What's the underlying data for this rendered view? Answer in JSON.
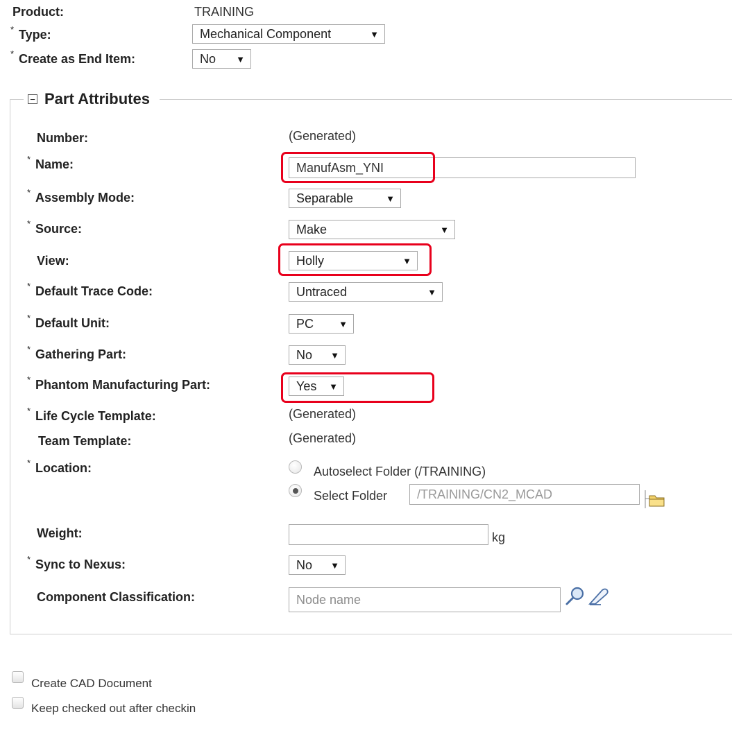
{
  "header": {
    "product_label": "Product:",
    "product_value": "TRAINING",
    "type_label": "Type:",
    "type_value": "Mechanical Component",
    "end_item_label": "Create as End Item:",
    "end_item_value": "No",
    "required_marker": "*"
  },
  "section": {
    "title": "Part Attributes",
    "collapse_symbol": "⊟"
  },
  "fields": {
    "number": {
      "label": "Number:",
      "value": "(Generated)"
    },
    "name": {
      "label": "Name:",
      "value": "ManufAsm_YNI"
    },
    "assembly_mode": {
      "label": "Assembly Mode:",
      "value": "Separable"
    },
    "source": {
      "label": "Source:",
      "value": "Make"
    },
    "view": {
      "label": "View:",
      "value": "Holly"
    },
    "trace_code": {
      "label": "Default Trace Code:",
      "value": "Untraced"
    },
    "default_unit": {
      "label": "Default Unit:",
      "value": "PC"
    },
    "gathering_part": {
      "label": "Gathering Part:",
      "value": "No"
    },
    "phantom": {
      "label": "Phantom Manufacturing Part:",
      "value": "Yes"
    },
    "life_cycle": {
      "label": "Life Cycle Template:",
      "value": "(Generated)"
    },
    "team_template": {
      "label": "Team Template:",
      "value": "(Generated)"
    },
    "location": {
      "label": "Location:",
      "autoselect_label": "Autoselect Folder (/TRAINING)",
      "select_label": "Select Folder",
      "folder_value": "/TRAINING/CN2_MCAD"
    },
    "weight": {
      "label": "Weight:",
      "value": "",
      "unit": "kg"
    },
    "sync_nexus": {
      "label": "Sync to Nexus:",
      "value": "No"
    },
    "classification": {
      "label": "Component Classification:",
      "placeholder": "Node name"
    }
  },
  "options": {
    "create_cad": "Create CAD Document",
    "keep_checked_out": "Keep checked out after checkin"
  },
  "icons": {
    "dropdown_arrow": "▼",
    "highlight_color": "#e8001c"
  }
}
